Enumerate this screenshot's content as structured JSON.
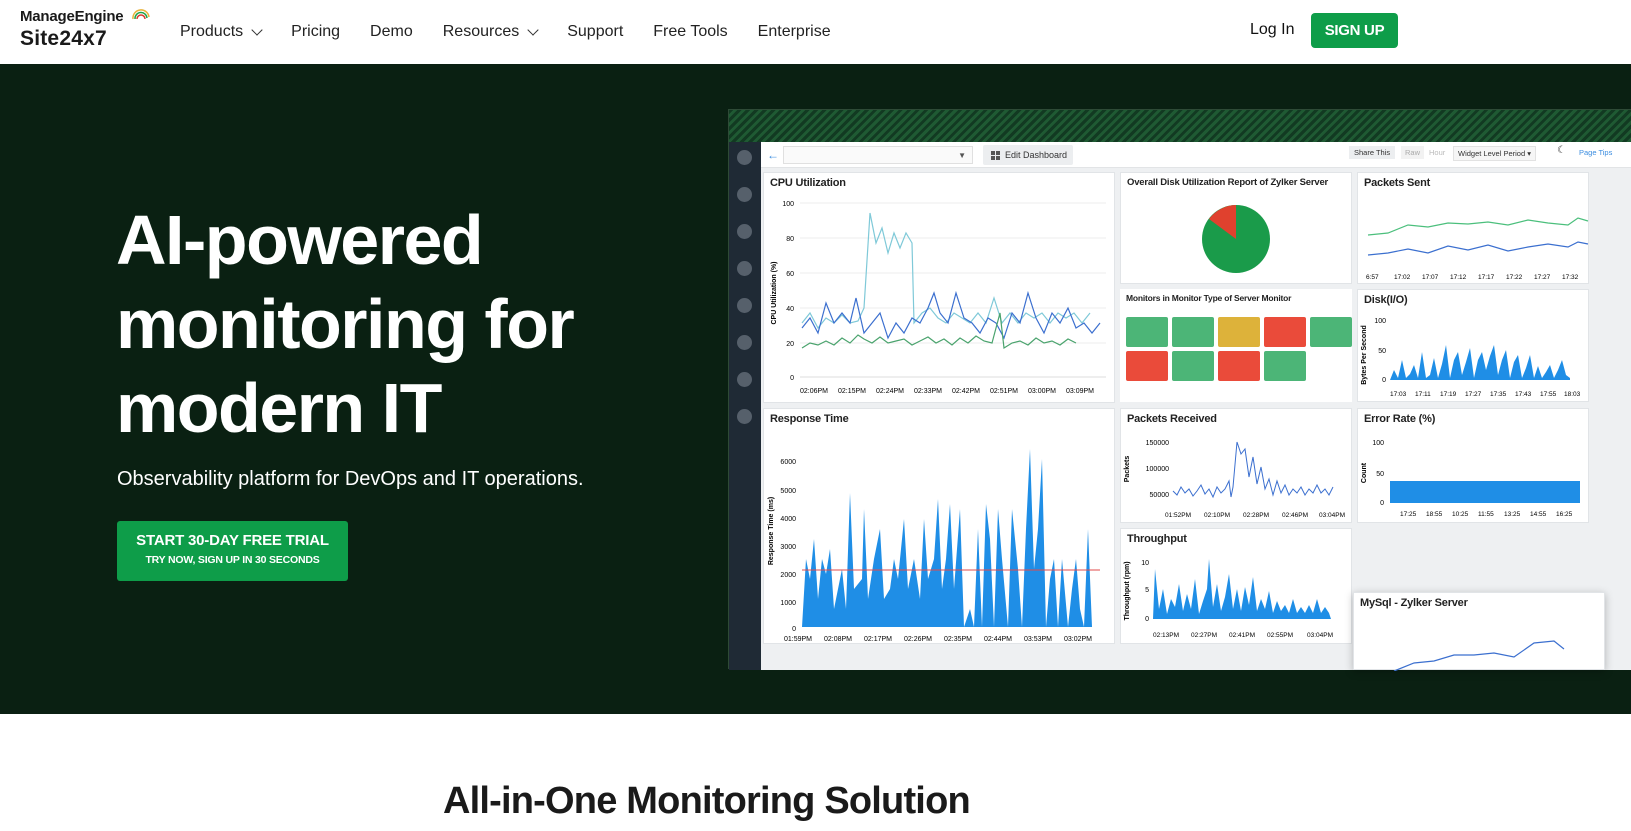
{
  "header": {
    "logo_top": "ManageEngine",
    "logo_bottom": "Site24x7",
    "nav": [
      {
        "label": "Products",
        "dropdown": true
      },
      {
        "label": "Pricing",
        "dropdown": false
      },
      {
        "label": "Demo",
        "dropdown": false
      },
      {
        "label": "Resources",
        "dropdown": true
      },
      {
        "label": "Support",
        "dropdown": false
      },
      {
        "label": "Free Tools",
        "dropdown": false
      },
      {
        "label": "Enterprise",
        "dropdown": false
      }
    ],
    "login": "Log In",
    "signup": "SIGN UP"
  },
  "hero": {
    "title_lines": [
      "AI-powered",
      "monitoring for",
      "modern IT"
    ],
    "subtitle": "Observability platform for DevOps and IT operations.",
    "cta_main": "START 30-DAY FREE TRIAL",
    "cta_sub": "TRY NOW, SIGN UP IN 30 SECONDS"
  },
  "dashboard": {
    "toolbar": {
      "back": "←",
      "edit": "Edit Dashboard",
      "share": "Share This",
      "raw": "Raw",
      "hour": "Hour",
      "period": "Widget Level Period",
      "tips": "Page Tips"
    },
    "widgets": {
      "cpu": {
        "title": "CPU Utilization",
        "ylabel": "CPU Utilization (%)",
        "yticks": [
          "100",
          "80",
          "60",
          "40",
          "20",
          "0"
        ],
        "xticks": [
          "02:06PM",
          "02:15PM",
          "02:24PM",
          "02:33PM",
          "02:42PM",
          "02:51PM",
          "03:00PM",
          "03:09PM"
        ]
      },
      "disk_report": {
        "title": "Overall Disk Utilization Report of Zylker Server"
      },
      "packets_sent": {
        "title": "Packets Sent",
        "xticks": [
          "6:57",
          "17:02",
          "17:07",
          "17:12",
          "17:17",
          "17:22",
          "17:27",
          "17:32"
        ]
      },
      "monitors": {
        "title": "Monitors in Monitor Type of Server Monitor"
      },
      "disk_io": {
        "title": "Disk(I/O)",
        "ylabel": "Bytes Per Second",
        "yticks": [
          "100",
          "50",
          "0"
        ],
        "xticks": [
          "17:03",
          "17:11",
          "17:19",
          "17:27",
          "17:35",
          "17:43",
          "17:55",
          "18:03"
        ]
      },
      "response": {
        "title": "Response Time",
        "ylabel": "Response Time (ms)",
        "yticks": [
          "6000",
          "5000",
          "4000",
          "3000",
          "2000",
          "1000",
          "0"
        ],
        "xticks": [
          "01:59PM",
          "02:08PM",
          "02:17PM",
          "02:26PM",
          "02:35PM",
          "02:44PM",
          "03:53PM",
          "03:02PM"
        ]
      },
      "packets_received": {
        "title": "Packets Received",
        "ylabel": "Packets",
        "yticks": [
          "150000",
          "100000",
          "50000"
        ],
        "xticks": [
          "01:52PM",
          "02:10PM",
          "02:28PM",
          "02:46PM",
          "03:04PM"
        ]
      },
      "error_rate": {
        "title": "Error Rate (%)",
        "ylabel": "Count",
        "yticks": [
          "100",
          "50",
          "0"
        ],
        "xticks": [
          "17:25",
          "18:55",
          "10:25",
          "11:55",
          "13:25",
          "14:55",
          "16:25"
        ]
      },
      "throughput": {
        "title": "Throughput",
        "ylabel": "Throughput (rpm)",
        "yticks": [
          "10",
          "5",
          "0"
        ],
        "xticks": [
          "02:13PM",
          "02:27PM",
          "02:41PM",
          "02:55PM",
          "03:04PM"
        ]
      },
      "mysql": {
        "title": "MySql - Zylker Server"
      }
    },
    "colors": {
      "status": [
        "green",
        "green",
        "yellow",
        "red",
        "green",
        "red",
        "green",
        "red",
        "green"
      ]
    }
  },
  "section": {
    "title": "All-in-One Monitoring Solution"
  }
}
